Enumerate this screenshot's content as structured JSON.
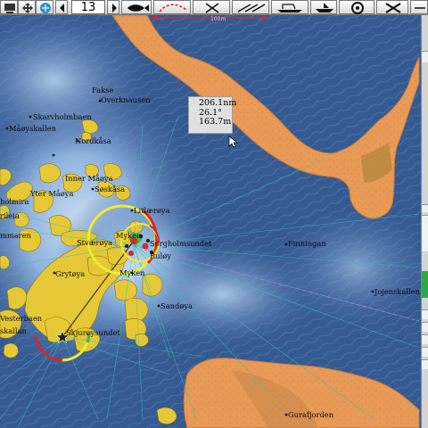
{
  "toolbar": {
    "zoom_value": "13",
    "icons": [
      "monitor-icon",
      "pan-arrows-icon",
      "route-icon",
      "arrow-left-icon",
      "arrow-right-icon",
      "fish-icon",
      "curve-track-icon",
      "grid-lines-icon",
      "cross-mark-icon",
      "parallel-lines-icon",
      "boat-icon",
      "fish-school-icon",
      "target-icon",
      "tools-icon"
    ],
    "scale_label": "100m"
  },
  "measure": {
    "distance": "206.1nm",
    "bearing": "26.1°",
    "depth": "163.7m"
  },
  "places": [
    {
      "id": "fakse",
      "name": "Fakse"
    },
    {
      "id": "overknausen",
      "name": "Overknausen"
    },
    {
      "id": "skarvholmbaen",
      "name": "Skarvholmbaen"
    },
    {
      "id": "maoyskallen",
      "name": "Måøyskallen"
    },
    {
      "id": "nordkasa",
      "name": "Nordkåsa"
    },
    {
      "id": "inner-maoya",
      "name": "Inner Måøya"
    },
    {
      "id": "yter-maoya",
      "name": "Yter Måøya"
    },
    {
      "id": "holmira",
      "name": "holmira"
    },
    {
      "id": "soskasa",
      "name": "Søskåsa"
    },
    {
      "id": "rileia",
      "name": "rileia"
    },
    {
      "id": "litlaeroya",
      "name": "Litlærøya"
    },
    {
      "id": "mmaren",
      "name": "mmaren"
    },
    {
      "id": "myken-n",
      "name": "Myken"
    },
    {
      "id": "storaeroya",
      "name": "Stværøya"
    },
    {
      "id": "sorgholmsundet",
      "name": "Sorgholmsundet"
    },
    {
      "id": "ruloy",
      "name": "Ruløy"
    },
    {
      "id": "finningan",
      "name": "Finningan"
    },
    {
      "id": "grytoya",
      "name": "Grytøya"
    },
    {
      "id": "myken-s",
      "name": "Myken"
    },
    {
      "id": "jojenskallen",
      "name": "Jojenskallen"
    },
    {
      "id": "sandoya",
      "name": "Sandøya"
    },
    {
      "id": "vesterbaen",
      "name": "Vesterbaen"
    },
    {
      "id": "skallan",
      "name": "skallan"
    },
    {
      "id": "skjuroysundet",
      "name": "Skjurøysundet"
    },
    {
      "id": "gurafjorden",
      "name": "Gurafjorden"
    }
  ],
  "colors": {
    "sea_deep": "#2f4f86",
    "sea_light": "#6f9bd0",
    "land": "#e6c837",
    "sand": "#e89a57",
    "accent_red": "#d9262a",
    "accent_yellow": "#f0ee2a",
    "accent_green": "#39b54a"
  }
}
